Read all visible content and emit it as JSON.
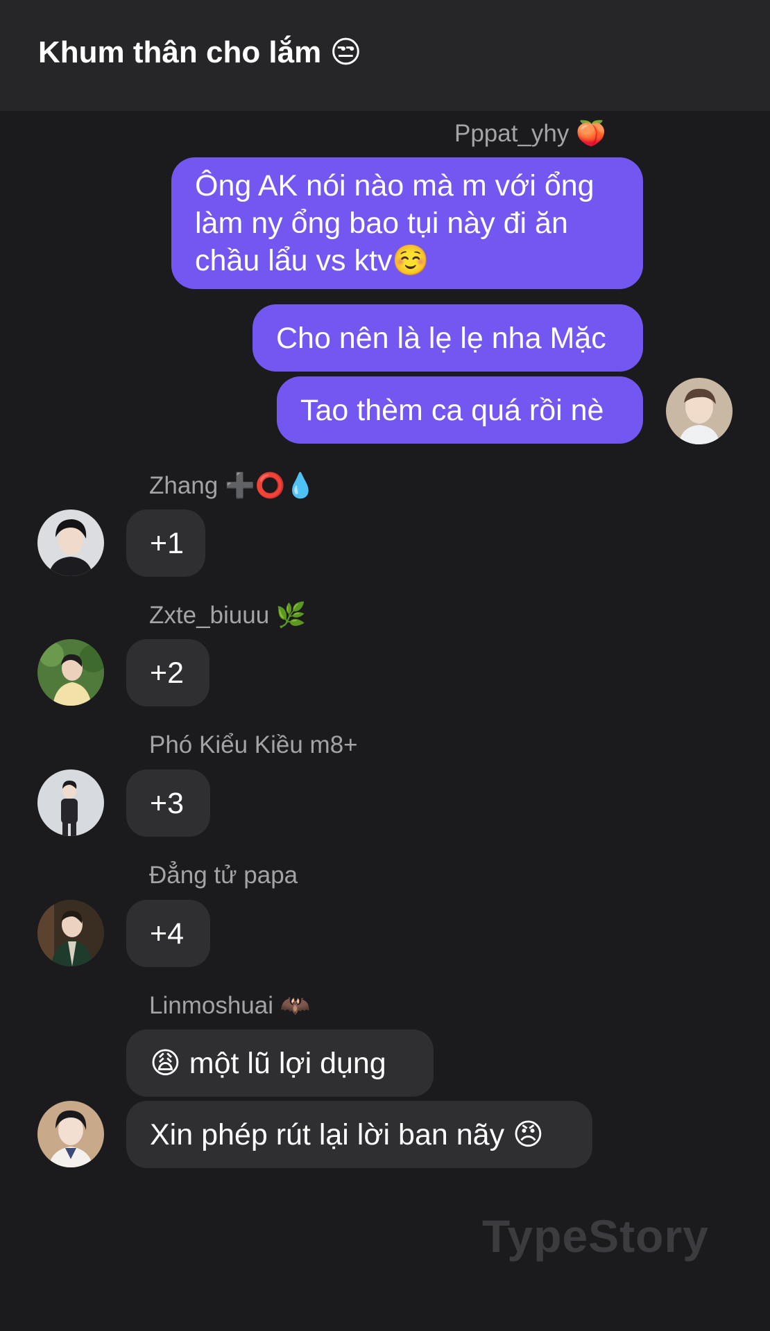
{
  "header": {
    "title": "Khum thân cho lắm 😒"
  },
  "messages": {
    "outgoing": {
      "sender": "Pppat_yhy 🍑",
      "bubbles": [
        "Ông AK nói nào mà m với ổng làm ny ổng bao tụi này đi ăn chầu lẩu vs ktv☺️",
        "Cho nên là lẹ lẹ nha Mặc",
        "Tao thèm ca quá rồi nè"
      ]
    },
    "incoming": [
      {
        "sender": "Zhang ➕⭕️💧",
        "bubbles": [
          "+1"
        ]
      },
      {
        "sender": "Zxte_biuuu 🌿",
        "bubbles": [
          "+2"
        ]
      },
      {
        "sender": "Phó Kiểu Kiều m8+",
        "bubbles": [
          "+3"
        ]
      },
      {
        "sender": "Đẳng tử papa",
        "bubbles": [
          "+4"
        ]
      },
      {
        "sender": "Linmoshuai 🦇",
        "bubbles": [
          "😩 một lũ lợi dụng",
          "Xin phép rút lại lời ban nãy 😠"
        ]
      }
    ]
  },
  "watermark": "TypeStory",
  "colors": {
    "background": "#1b1b1d",
    "header": "#262628",
    "outgoing_bubble": "#7457f1",
    "incoming_bubble": "#2f2f32",
    "sender_name": "#a3a3a8"
  }
}
